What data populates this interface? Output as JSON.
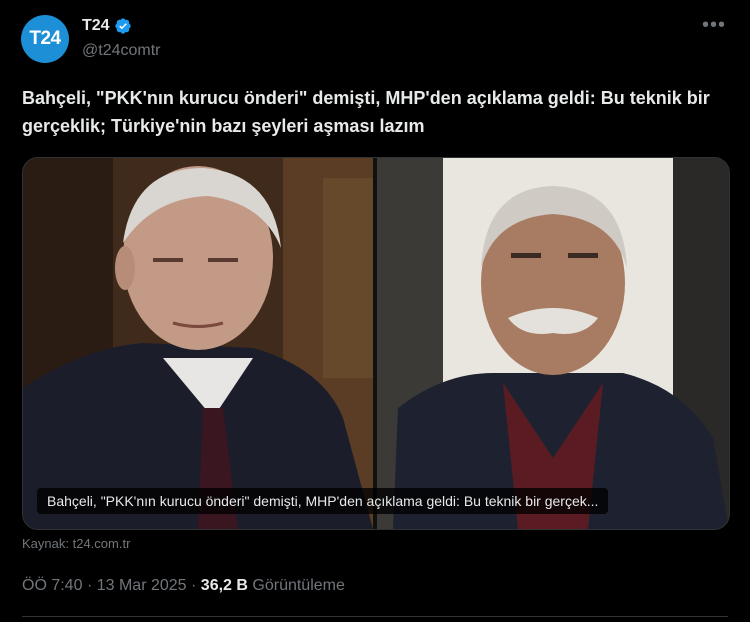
{
  "account": {
    "avatar_text": "T24",
    "display_name": "T24",
    "handle": "@t24comtr",
    "verified": true
  },
  "more_icon": "more-horizontal-icon",
  "tweet": {
    "text": "Bahçeli, \"PKK'nın kurucu önderi\" demişti, MHP'den açıklama geldi: Bu teknik bir gerçeklik; Türkiye'nin bazı şeyleri aşması lazım"
  },
  "card": {
    "caption": "Bahçeli, \"PKK'nın kurucu önderi\" demişti, MHP'den açıklama geldi: Bu teknik bir gerçek...",
    "source_label": "Kaynak:",
    "source_domain": "t24.com.tr"
  },
  "meta": {
    "time": "ÖÖ 7:40",
    "separator": "·",
    "date": "13 Mar 2025",
    "views_count": "36,2 B",
    "views_label": "Görüntüleme"
  },
  "colors": {
    "background": "#000000",
    "text": "#e7e9ea",
    "muted": "#71767b",
    "verified": "#1d9bf0",
    "avatar": "#1d8fd6"
  }
}
